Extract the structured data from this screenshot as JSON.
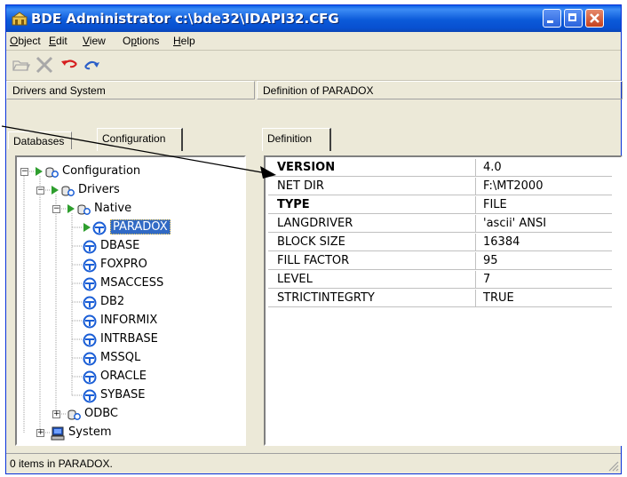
{
  "window": {
    "title": "BDE Administrator  c:\\bde32\\IDAPI32.CFG"
  },
  "menu": [
    {
      "label": "Object",
      "u": "O",
      "rest": "bject"
    },
    {
      "label": "Edit",
      "u": "E",
      "rest": "dit"
    },
    {
      "label": "View",
      "u": "V",
      "rest": "iew"
    },
    {
      "label": "Options",
      "u": "p",
      "pre": "O",
      "rest": "tions"
    },
    {
      "label": "Help",
      "u": "H",
      "rest": "elp"
    }
  ],
  "toolbar": {
    "icons": [
      "open-icon",
      "delete-icon",
      "undo-icon",
      "redo-icon"
    ]
  },
  "left_pane": {
    "header": "Drivers and System",
    "tabs": [
      "Databases",
      "Configuration"
    ],
    "tree": [
      {
        "label": "Configuration",
        "icon": "config-icon",
        "level": 0,
        "expander": "−"
      },
      {
        "label": "Drivers",
        "icon": "config-icon",
        "level": 1,
        "expander": "−"
      },
      {
        "label": "Native",
        "icon": "config-icon",
        "level": 2,
        "expander": "−"
      },
      {
        "label": "PARADOX",
        "icon": "driver-icon",
        "level": 3,
        "selected": true
      },
      {
        "label": "DBASE",
        "icon": "driver-icon",
        "level": 3
      },
      {
        "label": "FOXPRO",
        "icon": "driver-icon",
        "level": 3
      },
      {
        "label": "MSACCESS",
        "icon": "driver-icon",
        "level": 3
      },
      {
        "label": "DB2",
        "icon": "driver-icon",
        "level": 3
      },
      {
        "label": "INFORMIX",
        "icon": "driver-icon",
        "level": 3
      },
      {
        "label": "INTRBASE",
        "icon": "driver-icon",
        "level": 3
      },
      {
        "label": "MSSQL",
        "icon": "driver-icon",
        "level": 3
      },
      {
        "label": "ORACLE",
        "icon": "driver-icon",
        "level": 3
      },
      {
        "label": "SYBASE",
        "icon": "driver-icon",
        "level": 3
      },
      {
        "label": "ODBC",
        "icon": "config-icon",
        "level": 2,
        "expander": "+"
      },
      {
        "label": "System",
        "icon": "computer-icon",
        "level": 1,
        "expander": "+"
      }
    ]
  },
  "right_pane": {
    "header": "Definition of PARADOX",
    "tab": "Definition",
    "rows": [
      {
        "key": "VERSION",
        "value": "4.0",
        "bold": true
      },
      {
        "key": "NET DIR",
        "value": "F:\\MT2000"
      },
      {
        "key": "TYPE",
        "value": "FILE",
        "bold": true
      },
      {
        "key": "LANGDRIVER",
        "value": "'ascii' ANSI"
      },
      {
        "key": "BLOCK SIZE",
        "value": "16384"
      },
      {
        "key": "FILL FACTOR",
        "value": "95"
      },
      {
        "key": "LEVEL",
        "value": "7"
      },
      {
        "key": "STRICTINTEGRTY",
        "value": "TRUE"
      }
    ]
  },
  "status": {
    "text": "0 items in PARADOX."
  },
  "colors": {
    "title_blue": "#0a5ee6",
    "selection": "#316ac5",
    "green_arrow": "#2e9e2e"
  }
}
